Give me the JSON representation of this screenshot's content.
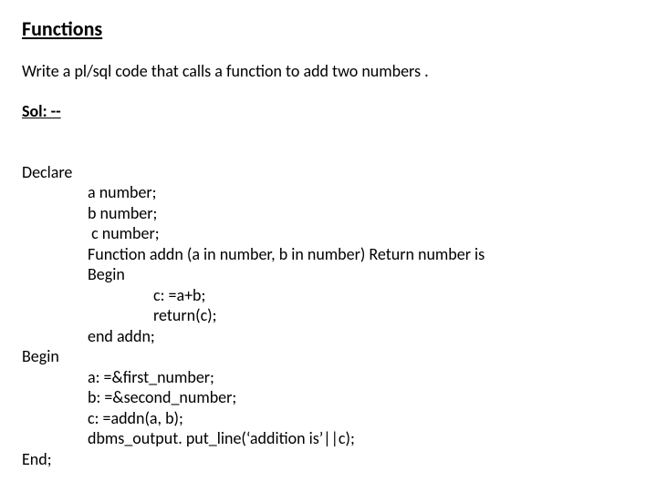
{
  "title": "Functions",
  "prompt": "Write a pl/sql code that calls a function to add two numbers .",
  "sol_label": "Sol: --",
  "code": {
    "declare": "Declare",
    "l1": "a number;",
    "l2": "b number;",
    "l3": " c number;",
    "l4": "Function addn (a in number, b in number) Return number is",
    "l5": "Begin",
    "l6": "c: =a+b;",
    "l7": "return(c);",
    "l8": "end addn;",
    "begin": "Begin",
    "l9": "a: =&first_number;",
    "l10": "b: =&second_number;",
    "l11": "c: =addn(a, b);",
    "l12": "dbms_output. put_line(‘addition is’||c);",
    "end": "End;"
  }
}
